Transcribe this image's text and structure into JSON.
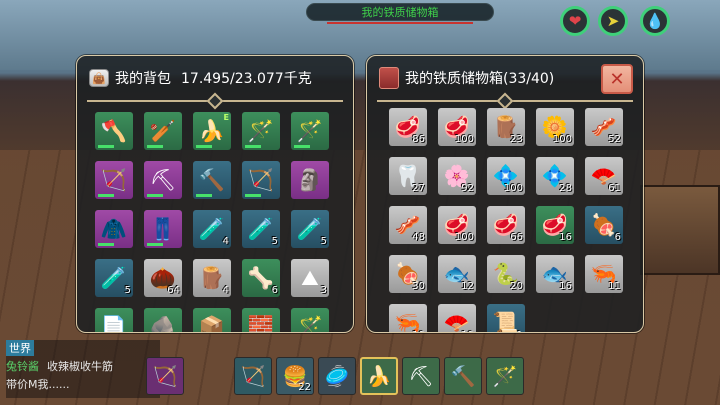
{
  "top_banner": {
    "title": "我的铁质储物箱"
  },
  "status_buttons": [
    {
      "icon": "heart-icon",
      "glyph": "❤",
      "color": "#e0444a"
    },
    {
      "icon": "energy-icon",
      "glyph": "➤",
      "color": "#e6d23a"
    },
    {
      "icon": "water-drop-icon",
      "glyph": "💧",
      "color": "#3fb4e6"
    }
  ],
  "backpack": {
    "title": "我的背包",
    "weight": "17.495/23.077千克",
    "slots": [
      {
        "icon": "🪓",
        "bg": "g",
        "count": "",
        "dur": true
      },
      {
        "icon": "🏏",
        "bg": "g",
        "count": "",
        "dur": true
      },
      {
        "icon": "🍌",
        "bg": "g",
        "count": "",
        "dur": true,
        "mark": "E"
      },
      {
        "icon": "🪄",
        "bg": "g",
        "count": "",
        "dur": true
      },
      {
        "icon": "🪄",
        "bg": "g",
        "count": "",
        "dur": true
      },
      {
        "icon": "🏹",
        "bg": "p",
        "count": "",
        "dur": true
      },
      {
        "icon": "⛏",
        "bg": "p",
        "count": "",
        "dur": true
      },
      {
        "icon": "🔨",
        "bg": "b",
        "count": "",
        "dur": true
      },
      {
        "icon": "🏹",
        "bg": "b",
        "count": "",
        "dur": true
      },
      {
        "icon": "🗿",
        "bg": "p",
        "count": "",
        "dur": false
      },
      {
        "icon": "🧥",
        "bg": "p",
        "count": "",
        "dur": true
      },
      {
        "icon": "👖",
        "bg": "p",
        "count": "",
        "dur": true
      },
      {
        "icon": "🧪",
        "bg": "b",
        "count": "4",
        "dur": false
      },
      {
        "icon": "🧪",
        "bg": "b",
        "count": "5",
        "dur": false
      },
      {
        "icon": "🧪",
        "bg": "b",
        "count": "5",
        "dur": false
      },
      {
        "icon": "🧪",
        "bg": "b",
        "count": "5",
        "dur": false
      },
      {
        "icon": "🌰",
        "bg": "w",
        "count": "64",
        "dur": false
      },
      {
        "icon": "🪵",
        "bg": "w",
        "count": "4",
        "dur": false
      },
      {
        "icon": "🦴",
        "bg": "g",
        "count": "6",
        "dur": false
      },
      {
        "icon": "⛰",
        "bg": "w",
        "count": "3",
        "dur": false
      },
      {
        "icon": "📄",
        "bg": "g",
        "count": "",
        "dur": false
      },
      {
        "icon": "🪨",
        "bg": "g",
        "count": "",
        "dur": false
      },
      {
        "icon": "📦",
        "bg": "g",
        "count": "",
        "dur": false
      },
      {
        "icon": "🧱",
        "bg": "g",
        "count": "",
        "dur": false
      },
      {
        "icon": "🪄",
        "bg": "g",
        "count": "",
        "dur": false
      }
    ]
  },
  "chest": {
    "title": "我的铁质储物箱(33/40)",
    "close": "✕",
    "slots": [
      {
        "icon": "🥩",
        "bg": "w",
        "count": "86"
      },
      {
        "icon": "🥩",
        "bg": "w",
        "count": "100"
      },
      {
        "icon": "🪵",
        "bg": "w",
        "count": "23"
      },
      {
        "icon": "🌼",
        "bg": "w",
        "count": "100"
      },
      {
        "icon": "🥓",
        "bg": "w",
        "count": "52"
      },
      {
        "icon": "🦷",
        "bg": "w",
        "count": "27"
      },
      {
        "icon": "🌸",
        "bg": "w",
        "count": "92"
      },
      {
        "icon": "💠",
        "bg": "w",
        "count": "100"
      },
      {
        "icon": "💠",
        "bg": "w",
        "count": "28"
      },
      {
        "icon": "🪭",
        "bg": "w",
        "count": "61"
      },
      {
        "icon": "🥓",
        "bg": "w",
        "count": "48"
      },
      {
        "icon": "🥩",
        "bg": "w",
        "count": "100"
      },
      {
        "icon": "🥩",
        "bg": "w",
        "count": "66"
      },
      {
        "icon": "🥩",
        "bg": "g",
        "count": "16"
      },
      {
        "icon": "🍖",
        "bg": "b",
        "count": "6"
      },
      {
        "icon": "🍖",
        "bg": "w",
        "count": "30"
      },
      {
        "icon": "🐟",
        "bg": "w",
        "count": "12"
      },
      {
        "icon": "🐍",
        "bg": "w",
        "count": "20"
      },
      {
        "icon": "🐟",
        "bg": "w",
        "count": "16"
      },
      {
        "icon": "🦐",
        "bg": "w",
        "count": "11"
      },
      {
        "icon": "🦐",
        "bg": "w",
        "count": "10"
      },
      {
        "icon": "🪭",
        "bg": "w",
        "count": "10"
      },
      {
        "icon": "📜",
        "bg": "b",
        "count": "1"
      }
    ]
  },
  "chat": {
    "channel": "世界",
    "nick": "兔铃酱",
    "message": "收辣椒收牛筋",
    "line2": "带价M我......"
  },
  "hotbar": [
    {
      "icon": "🏹",
      "count": "",
      "sel": false,
      "bg": "#6a2f72"
    },
    {
      "icon": "🏹",
      "count": "",
      "sel": false,
      "bg": "#2f5a63"
    },
    {
      "icon": "🍔",
      "count": "22",
      "sel": false,
      "bg": "#3a5a66"
    },
    {
      "icon": "🥏",
      "count": "",
      "sel": false,
      "bg": "#3a4a54"
    },
    {
      "icon": "🍌",
      "count": "",
      "sel": true,
      "bg": "#3d6a48"
    },
    {
      "icon": "⛏",
      "count": "",
      "sel": false,
      "bg": "#3d6a48"
    },
    {
      "icon": "🔨",
      "count": "",
      "sel": false,
      "bg": "#3d6a48"
    },
    {
      "icon": "🪄",
      "count": "",
      "sel": false,
      "bg": "#3d6a48"
    }
  ]
}
